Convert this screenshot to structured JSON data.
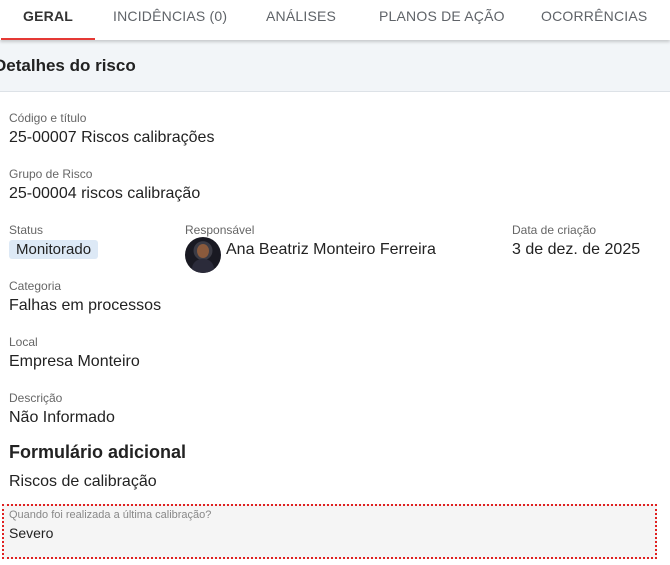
{
  "tabs": [
    {
      "label": "GERAL",
      "active": true
    },
    {
      "label": "INCIDÊNCIAS (0)",
      "active": false
    },
    {
      "label": "ANÁLISES",
      "active": false
    },
    {
      "label": "PLANOS DE AÇÃO",
      "active": false
    },
    {
      "label": "OCORRÊNCIAS",
      "active": false
    }
  ],
  "accent_color": "#e53935",
  "section_title": "Detalhes do risco",
  "details": {
    "codigo_label": "Código e título",
    "codigo_value": "25-00007 Riscos calibrações",
    "grupo_label": "Grupo de Risco",
    "grupo_value": "25-00004 riscos calibração",
    "status_label": "Status",
    "status_value": "Monitorado",
    "responsavel_label": "Responsável",
    "responsavel_value": "Ana Beatriz Monteiro Ferreira",
    "data_label": "Data de criação",
    "data_value": "3 de dez. de 2025",
    "categoria_label": "Categoria",
    "categoria_value": "Falhas em processos",
    "local_label": "Local",
    "local_value": "Empresa Monteiro",
    "descricao_label": "Descrição",
    "descricao_value": "Não Informado"
  },
  "form": {
    "title": "Formulário adicional",
    "name": "Riscos de calibração",
    "question_label": "Quando foi realizada a última calibração?",
    "question_value": "Severo"
  }
}
